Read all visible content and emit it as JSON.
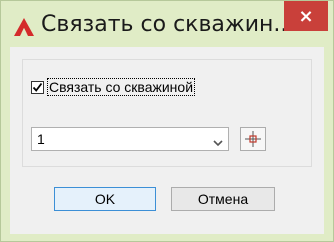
{
  "window": {
    "title": "Связать со скважин...",
    "close_symbol": "×",
    "app_icon": "autocad-a-icon"
  },
  "dialog": {
    "checkbox": {
      "label": "Связать со скважиной",
      "checked": true
    },
    "combo": {
      "value": "1"
    },
    "pick_button_icon": "crosshair-pick-icon",
    "ok_label": "OK",
    "cancel_label": "Отмена"
  },
  "colors": {
    "frame": "#e0ecc6",
    "close": "#c9403a",
    "client": "#f0f0f0",
    "app_icon": "#d42b2b",
    "pick_icon": "#c0392b"
  }
}
